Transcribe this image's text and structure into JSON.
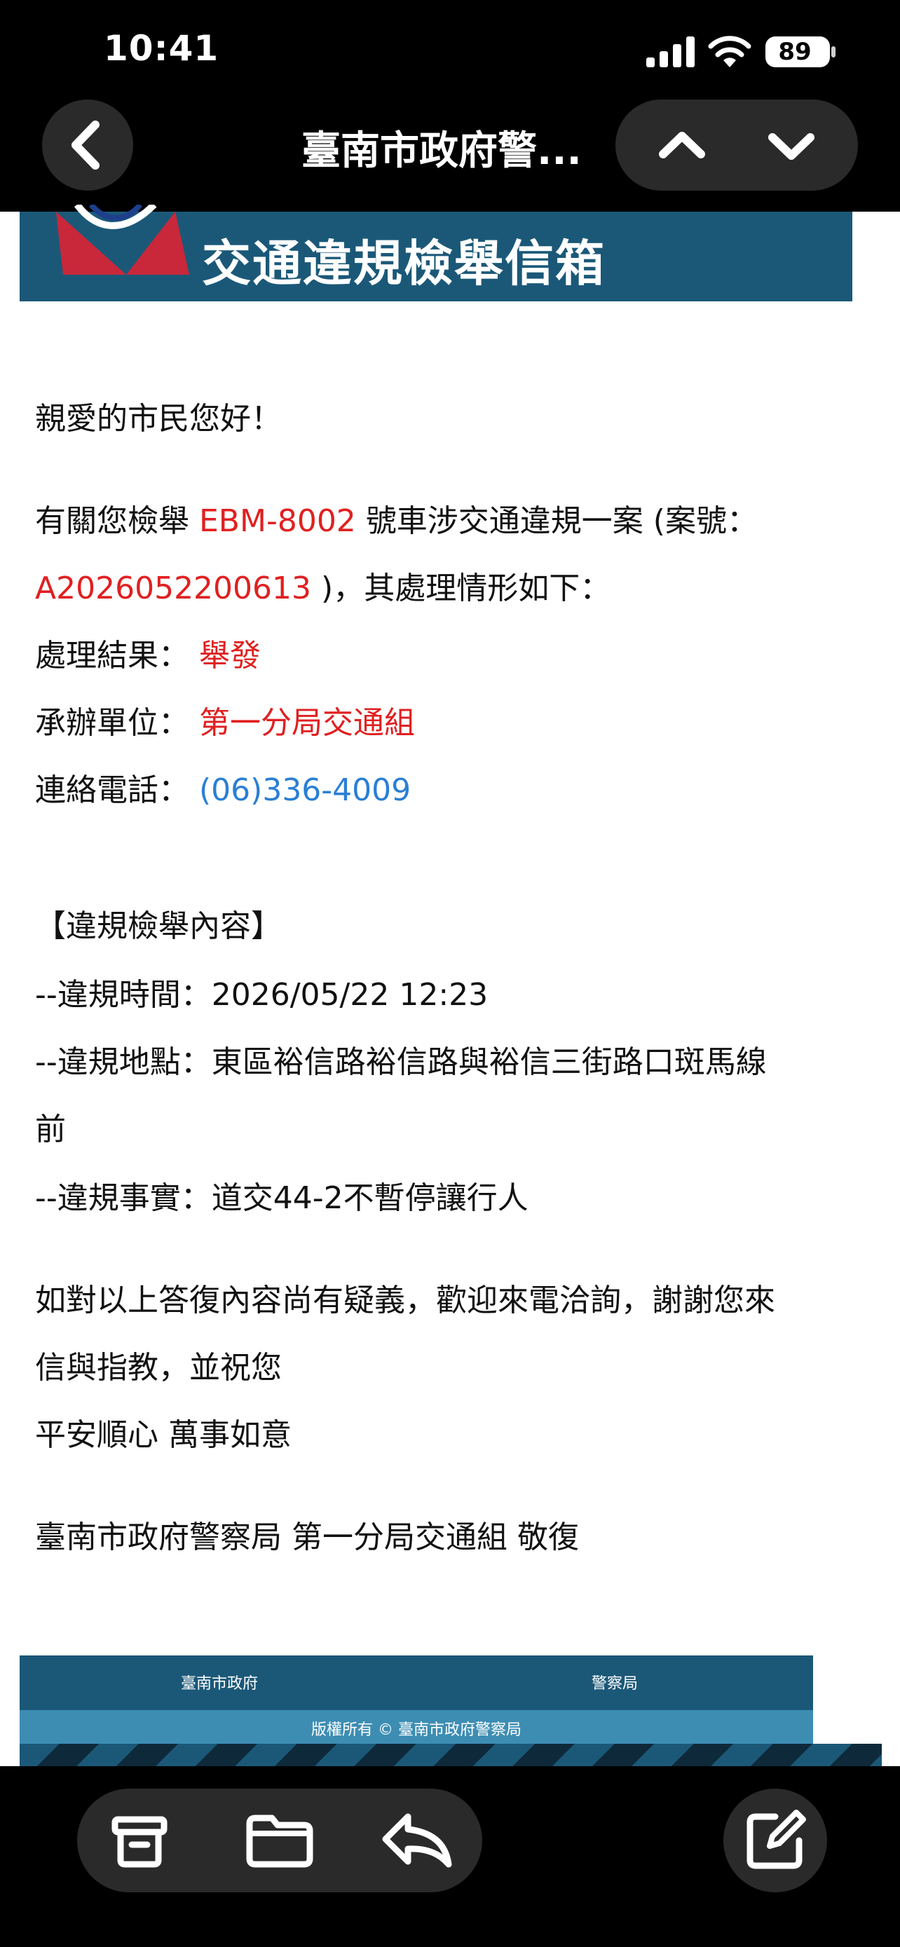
{
  "status_bar": {
    "time": "10:41",
    "battery": "89"
  },
  "nav": {
    "title": "臺南市政府警..."
  },
  "banner": {
    "title": "交通違規檢舉信箱"
  },
  "email": {
    "greeting": "親愛的市民您好！",
    "intro_a": "有關您檢舉",
    "plate": "EBM-8002",
    "intro_b": "號車涉交通違規一案 (案號：",
    "case_no": "A2026052200613",
    "intro_c": ")，其處理情形如下：",
    "result_label": "處理結果：",
    "result_value": "舉發",
    "unit_label": "承辦單位：",
    "unit_value": "第一分局交通組",
    "phone_label": "連絡電話：",
    "phone_value": "(06)336-4009",
    "section_title": "【違規檢舉內容】",
    "time_line": "--違規時間：2026/05/22 12:23",
    "place_line1": "--違規地點：東區裕信路裕信路與裕信三街路口斑馬線",
    "place_line2": "前",
    "fact_line": "--違規事實：道交44-2不暫停讓行人",
    "closing_1": "如對以上答復內容尚有疑義，歡迎來電洽詢，謝謝您來",
    "closing_2": "信與指教，並祝您",
    "closing_3": "平安順心 萬事如意",
    "signature": "臺南市政府警察局 第一分局交通組 敬復"
  },
  "footer": {
    "left": "臺南市政府",
    "right": "警察局",
    "copyright": "版權所有 © 臺南市政府警察局"
  },
  "colors": {
    "banner": "#1b5878",
    "highlight_red": "#e02020",
    "link_blue": "#2a7fd4"
  },
  "icons": [
    "back-chevron-icon",
    "chevron-up-icon",
    "chevron-down-icon",
    "archive-icon",
    "folder-icon",
    "reply-icon",
    "compose-icon",
    "signal-icon",
    "wifi-icon",
    "battery-icon",
    "police-logo-icon"
  ]
}
